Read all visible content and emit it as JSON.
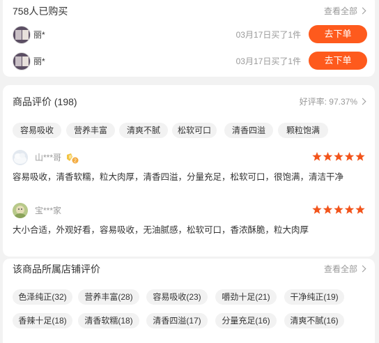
{
  "buyers": {
    "title": "758人已购买",
    "view_all": "查看全部",
    "list": [
      {
        "name": "丽*",
        "time": "03月17日买了1件",
        "button": "去下单"
      },
      {
        "name": "丽*",
        "time": "03月17日买了1件",
        "button": "去下单"
      }
    ]
  },
  "reviews": {
    "title": "商品评价 (198)",
    "rating_label": "好评率: 97.37%",
    "tags": [
      "容易吸收",
      "营养丰富",
      "清爽不腻",
      "松软可口",
      "清香四溢",
      "颗粒饱满"
    ],
    "items": [
      {
        "user": "山***哥",
        "badge_level": "2",
        "stars": 5,
        "text": "容易吸收，清香软糯，粒大肉厚，清香四溢，分量充足，松软可口，很饱满，清洁干净"
      },
      {
        "user": "宝***家",
        "stars": 5,
        "text": "大小合适，外观好看，容易吸收，无油腻感，松软可口，香浓酥脆，粒大肉厚"
      }
    ]
  },
  "shop_reviews": {
    "title": "该商品所属店铺评价",
    "view_all": "查看全部",
    "tags": [
      "色泽纯正(32)",
      "营养丰富(28)",
      "容易吸收(23)",
      "嚼劲十足(21)",
      "干净纯正(19)",
      "香辣十足(18)",
      "清香软糯(18)",
      "清香四溢(17)",
      "分量充足(16)",
      "清爽不腻(16)"
    ]
  },
  "colors": {
    "accent": "#fe5a1d",
    "star": "#f2541b",
    "tag_bg": "#f2f2f2",
    "muted": "#999999"
  }
}
